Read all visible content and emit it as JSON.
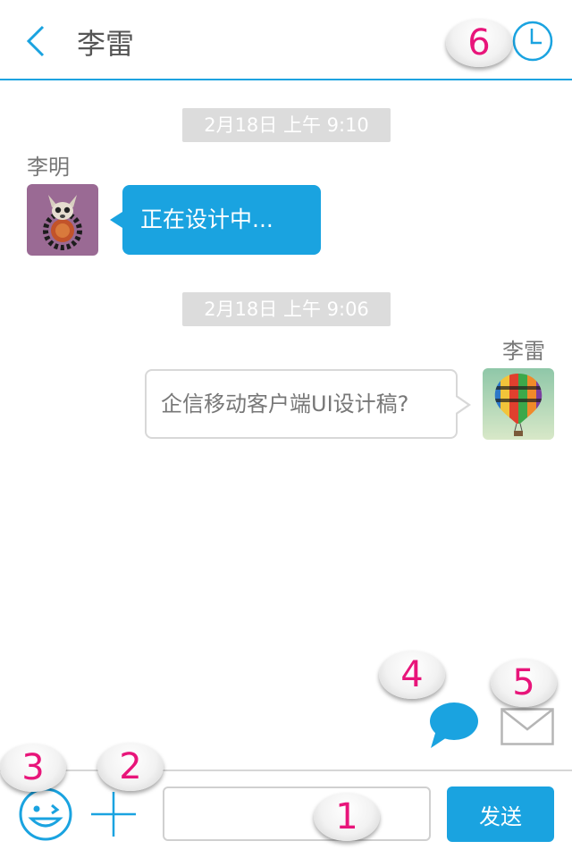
{
  "header": {
    "title": "李雷",
    "back_icon": "chevron-left-icon",
    "history_icon": "clock-icon"
  },
  "messages": [
    {
      "timestamp": "2月18日 上午 9:10",
      "sender": "李明",
      "direction": "incoming",
      "avatar": "cartoon-lemur-avatar",
      "text": "正在设计中..."
    },
    {
      "timestamp": "2月18日 上午 9:06",
      "sender": "李雷",
      "direction": "outgoing",
      "avatar": "hot-air-balloon-avatar",
      "text": "企信移动客户端UI设计稿?"
    }
  ],
  "actions": {
    "chat_icon": "chat-bubble-icon",
    "mail_icon": "envelope-icon"
  },
  "composer": {
    "emoji_icon": "emoji-icon",
    "plus_icon": "plus-icon",
    "input_value": "",
    "send_label": "发送"
  },
  "annotations": [
    "1",
    "2",
    "3",
    "4",
    "5",
    "6"
  ],
  "colors": {
    "accent": "#1aa3e0",
    "badge_text": "#e8157a",
    "timestamp_bg": "#dcdcdc"
  }
}
